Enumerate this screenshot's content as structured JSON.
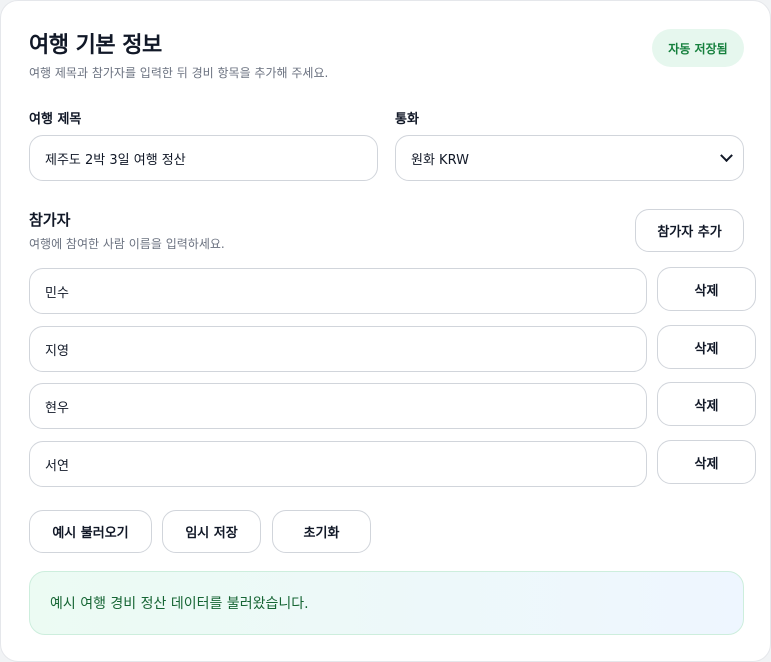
{
  "header": {
    "title": "여행 기본 정보",
    "subtitle": "여행 제목과 참가자를 입력한 뒤 경비 항목을 추가해 주세요.",
    "autosave_badge": "자동 저장됨"
  },
  "trip": {
    "title_label": "여행 제목",
    "title_value": "제주도 2박 3일 여행 정산",
    "currency_label": "통화",
    "currency_value": "원화 KRW"
  },
  "participants": {
    "title": "참가자",
    "description": "여행에 참여한 사람 이름을 입력하세요.",
    "add_button": "참가자 추가",
    "delete_label": "삭제",
    "names": [
      "민수",
      "지영",
      "현우",
      "서연"
    ]
  },
  "actions": {
    "load_example": "예시 불러오기",
    "temp_save": "임시 저장",
    "reset": "초기화"
  },
  "notice": {
    "message": "예시 여행 경비 정산 데이터를 불러왔습니다."
  },
  "colors": {
    "accent_green": "#15803d",
    "badge_bg": "#e6f7ee",
    "border": "#d1d5db"
  }
}
